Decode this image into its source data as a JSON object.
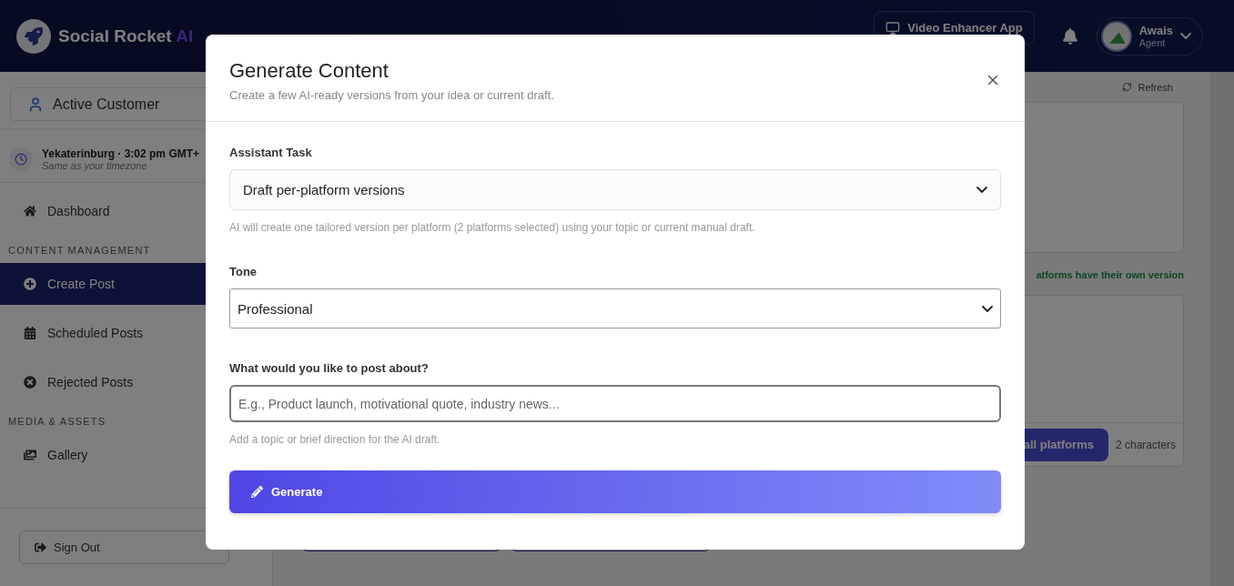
{
  "brand": {
    "name": "Social Rocket",
    "suffix": "AI"
  },
  "header": {
    "app_button": "Video Enhancer App",
    "user": {
      "name": "Awais",
      "role": "Agent"
    }
  },
  "sidebar": {
    "customer_button": "Active Customer",
    "timezone": {
      "place_time": "Yekaterinburg · 3:02 pm GMT+",
      "note": "Same as your timezone"
    },
    "sections": [
      {
        "items": [
          {
            "label": "Dashboard",
            "selected": false
          }
        ]
      },
      {
        "heading": "CONTENT MANAGEMENT",
        "items": [
          {
            "label": "Create Post",
            "selected": true
          },
          {
            "label": "Scheduled Posts",
            "selected": false
          },
          {
            "label": "Rejected Posts",
            "selected": false
          }
        ]
      },
      {
        "heading": "MEDIA & ASSETS",
        "items": [
          {
            "label": "Gallery",
            "selected": false
          }
        ]
      }
    ],
    "sign_out": "Sign Out"
  },
  "main": {
    "refresh": "Refresh",
    "status": "atforms have their own version",
    "apply_button": "all platforms",
    "char_count": "2 characters"
  },
  "modal": {
    "title": "Generate Content",
    "subtitle": "Create a few AI-ready versions from your idea or current draft.",
    "fields": [
      {
        "kind": "select",
        "label": "Assistant Task",
        "value": "Draft per-platform versions",
        "hint": "AI will create one tailored version per platform (2 platforms selected) using your topic or current manual draft."
      },
      {
        "kind": "select",
        "label": "Tone",
        "value": "Professional"
      },
      {
        "kind": "input",
        "label": "What would you like to post about?",
        "placeholder": "E.g., Product launch, motivational quote, industry news...",
        "hint": "Add a topic or brief direction for the AI draft."
      }
    ],
    "submit": "Generate"
  }
}
